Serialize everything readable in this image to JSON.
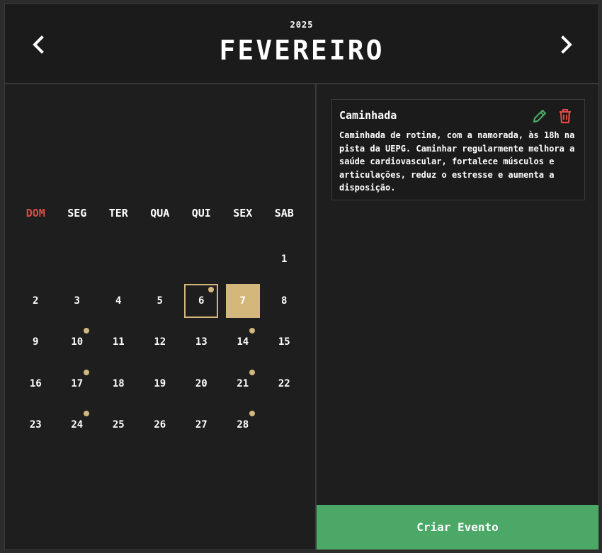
{
  "header": {
    "year": "2025",
    "month": "FEVEREIRO",
    "prev_icon": "chevron-left-icon",
    "next_icon": "chevron-right-icon"
  },
  "calendar": {
    "weekdays": [
      "DOM",
      "SEG",
      "TER",
      "QUA",
      "QUI",
      "SEX",
      "SAB"
    ],
    "leading_blanks": 6,
    "days": [
      {
        "n": "1",
        "event": false
      },
      {
        "n": "2",
        "event": false
      },
      {
        "n": "3",
        "event": false
      },
      {
        "n": "4",
        "event": false
      },
      {
        "n": "5",
        "event": false
      },
      {
        "n": "6",
        "event": true,
        "today": true
      },
      {
        "n": "7",
        "event": false,
        "selected": true
      },
      {
        "n": "8",
        "event": false
      },
      {
        "n": "9",
        "event": false
      },
      {
        "n": "10",
        "event": true
      },
      {
        "n": "11",
        "event": false
      },
      {
        "n": "12",
        "event": false
      },
      {
        "n": "13",
        "event": false
      },
      {
        "n": "14",
        "event": true
      },
      {
        "n": "15",
        "event": false
      },
      {
        "n": "16",
        "event": false
      },
      {
        "n": "17",
        "event": true
      },
      {
        "n": "18",
        "event": false
      },
      {
        "n": "19",
        "event": false
      },
      {
        "n": "20",
        "event": false
      },
      {
        "n": "21",
        "event": true
      },
      {
        "n": "22",
        "event": false
      },
      {
        "n": "23",
        "event": false
      },
      {
        "n": "24",
        "event": true
      },
      {
        "n": "25",
        "event": false
      },
      {
        "n": "26",
        "event": false
      },
      {
        "n": "27",
        "event": false
      },
      {
        "n": "28",
        "event": true
      }
    ]
  },
  "event": {
    "title": "Caminhada",
    "description": "Caminhada de rotina, com a namorada, às 18h na pista da UEPG. Caminhar regularmente melhora a saúde cardiovascular, fortalece músculos e articulações, reduz o estresse e aumenta a disposição.",
    "edit_icon": "pencil-icon",
    "delete_icon": "trash-icon"
  },
  "actions": {
    "create_label": "Criar Evento"
  },
  "colors": {
    "accent": "#d4b77a",
    "sunday": "#e04848",
    "create": "#4ba866",
    "edit": "#4ba866",
    "delete": "#e04848",
    "background": "#1e1e1e"
  }
}
